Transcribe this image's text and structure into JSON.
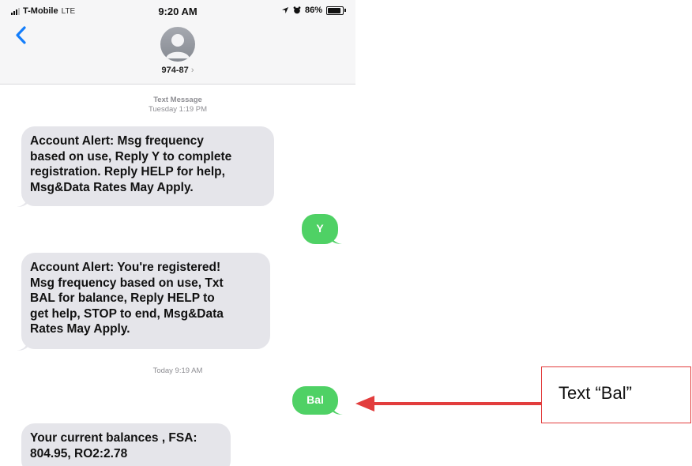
{
  "status_bar": {
    "carrier": "T-Mobile",
    "network": "LTE",
    "time": "9:20 AM",
    "battery": "86%",
    "battery_level": 0.86,
    "icons": [
      "signal-icon",
      "location-arrow-icon",
      "alarm-icon",
      "battery-icon"
    ]
  },
  "header": {
    "contact": "974-87",
    "contact_chevron": "›",
    "icons": [
      "back-chevron-icon",
      "contact-avatar-icon"
    ]
  },
  "conversation": {
    "ts1_label": "Text Message",
    "ts1_time": "Tuesday 1:19 PM",
    "msg1": [
      "Account Alert: Msg frequency",
      "based on use, Reply Y to complete",
      "registration. Reply HELP for help,",
      "Msg&Data Rates May Apply."
    ],
    "reply1": "Y",
    "msg2": [
      "Account Alert: You're registered!",
      "Msg frequency based on use, Txt",
      "BAL for balance, Reply HELP to",
      "get help, STOP to end, Msg&Data",
      "Rates May Apply."
    ],
    "ts2": "Today 9:19 AM",
    "reply2": "Bal",
    "msg3": [
      "Your current balances , FSA:",
      "804.95, RO2:2.78"
    ]
  },
  "annotation": {
    "text": "Text “Bal”",
    "color": "#e23d3d"
  },
  "colors": {
    "incoming_bubble": "#e5e5ea",
    "outgoing_bubble": "#4fd165",
    "ios_blue": "#147efb"
  }
}
